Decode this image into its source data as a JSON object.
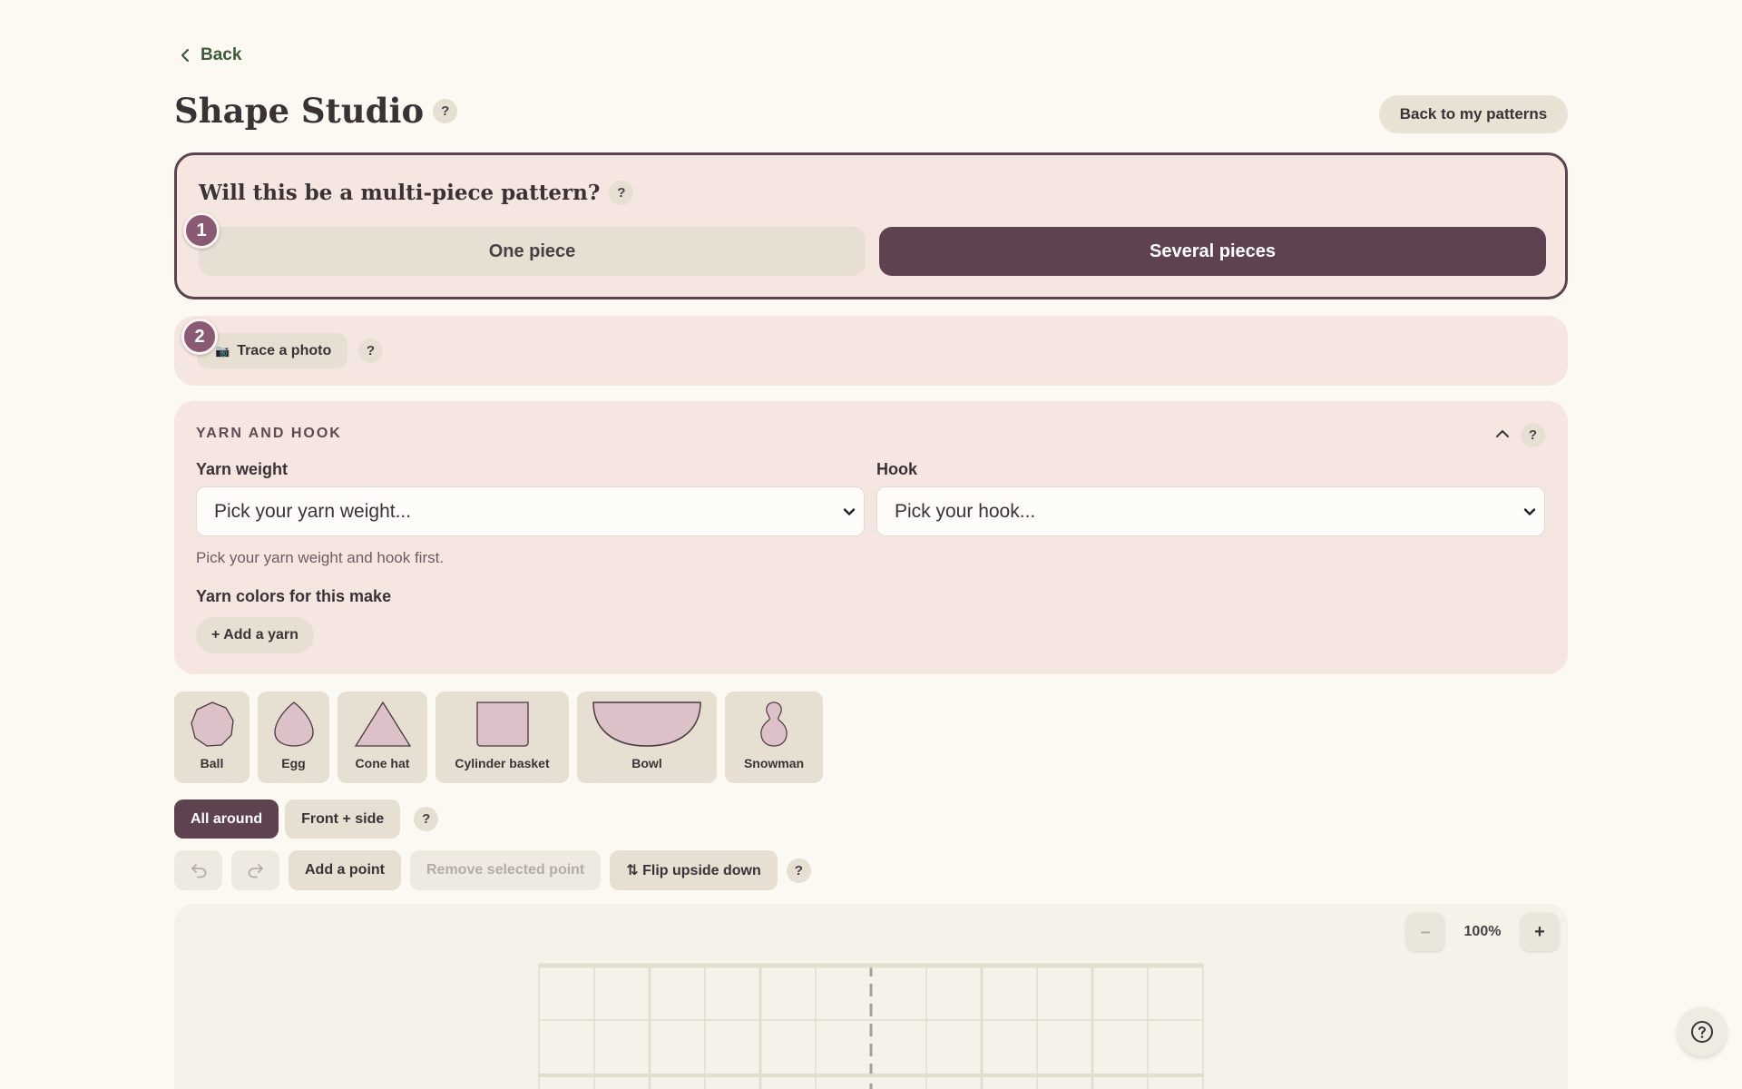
{
  "nav": {
    "back_label": "Back"
  },
  "header": {
    "title": "Shape Studio",
    "help": "?",
    "back_to_patterns": "Back to my patterns"
  },
  "step1": {
    "badge": "1",
    "question": "Will this be a multi-piece pattern?",
    "help": "?",
    "options": [
      "One piece",
      "Several pieces"
    ],
    "selected": "Several pieces"
  },
  "step2": {
    "badge": "2",
    "trace_icon": "📷",
    "trace_label": "Trace a photo",
    "help": "?"
  },
  "yarn": {
    "section_title": "YARN AND HOOK",
    "help": "?",
    "yarn_weight_label": "Yarn weight",
    "yarn_weight_value": "Pick your yarn weight...",
    "hook_label": "Hook",
    "hook_value": "Pick your hook...",
    "hint": "Pick your yarn weight and hook first.",
    "colors_label": "Yarn colors for this make",
    "add_yarn": "+ Add a yarn"
  },
  "shapes": [
    "Ball",
    "Egg",
    "Cone hat",
    "Cylinder basket",
    "Bowl",
    "Snowman"
  ],
  "views": {
    "active": "All around",
    "inactive": "Front + side",
    "help": "?"
  },
  "toolbar": {
    "add_point": "Add a point",
    "remove_point": "Remove selected point",
    "flip": "⇅ Flip upside down",
    "help": "?"
  },
  "canvas": {
    "zoom_minus": "–",
    "zoom_value": "100%",
    "zoom_plus": "+"
  },
  "colors": {
    "accent": "#5e4250",
    "badge": "#8a5a74",
    "card": "#f5e6e1",
    "link": "#3e5a38"
  },
  "icons": {
    "back": "chevron-left-icon",
    "undo": "undo-icon",
    "redo": "redo-icon",
    "collapse": "chevron-up-icon",
    "dropdown": "chevron-down-icon",
    "help": "question-circle-icon"
  }
}
